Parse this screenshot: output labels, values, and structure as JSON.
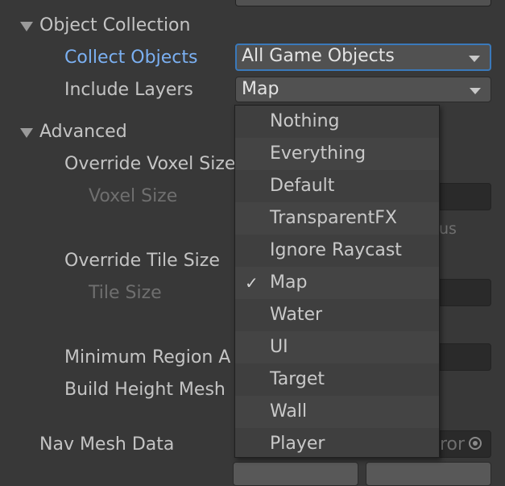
{
  "sections": {
    "object_collection": "Object Collection",
    "advanced": "Advanced"
  },
  "fields": {
    "collect_objects_label": "Collect Objects",
    "collect_objects_value": "All Game Objects",
    "include_layers_label": "Include Layers",
    "include_layers_value": "Map",
    "override_voxel_size_label": "Override Voxel Size",
    "voxel_size_label": "Voxel Size",
    "voxel_hint_fragment": "us",
    "override_tile_size_label": "Override Tile Size",
    "tile_size_label": "Tile Size",
    "minimum_region_area_label": "Minimum Region A",
    "build_height_mesh_label": "Build Height Mesh",
    "nav_mesh_data_label": "Nav Mesh Data",
    "nav_mesh_data_value_fragment": "ror"
  },
  "layer_menu": {
    "items": [
      {
        "label": "Nothing",
        "checked": false
      },
      {
        "label": "Everything",
        "checked": false
      },
      {
        "label": "Default",
        "checked": false
      },
      {
        "label": "TransparentFX",
        "checked": false
      },
      {
        "label": "Ignore Raycast",
        "checked": false
      },
      {
        "label": "Map",
        "checked": true
      },
      {
        "label": "Water",
        "checked": false
      },
      {
        "label": "UI",
        "checked": false
      },
      {
        "label": "Target",
        "checked": false
      },
      {
        "label": "Wall",
        "checked": false
      },
      {
        "label": "Player",
        "checked": false
      }
    ],
    "check_glyph": "✓"
  },
  "colors": {
    "background": "#383838",
    "accent": "#3a79bb",
    "highlight_label": "#7bb0f2"
  }
}
